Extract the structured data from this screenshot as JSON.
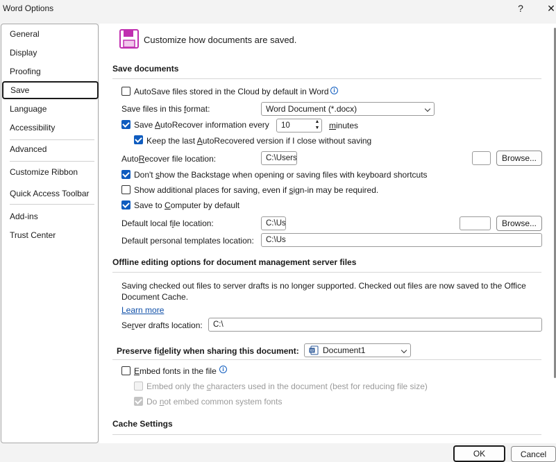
{
  "window": {
    "title": "Word Options",
    "help_glyph": "?",
    "close_glyph": "✕"
  },
  "sidebar": {
    "items": [
      {
        "label": "General"
      },
      {
        "label": "Display"
      },
      {
        "label": "Proofing"
      },
      {
        "label": "Save",
        "selected": true
      },
      {
        "label": "Language"
      },
      {
        "label": "Accessibility"
      },
      {
        "label": "Advanced"
      },
      {
        "label": "Customize Ribbon"
      },
      {
        "label": "Quick Access Toolbar"
      },
      {
        "label": "Add-ins"
      },
      {
        "label": "Trust Center"
      }
    ]
  },
  "header": {
    "icon": "floppy-disk-icon",
    "text": "Customize how documents are saved."
  },
  "save_documents": {
    "heading": "Save documents",
    "autosave_label": "AutoSave files stored in the Cloud by default in Word",
    "autosave_checked": false,
    "format_label_pre": "Save files in this ",
    "format_label_u": "f",
    "format_label_post": "ormat:",
    "format_value": "Word Document (*.docx)",
    "autorecover_pre": "Save ",
    "autorecover_u": "A",
    "autorecover_post": "utoRecover information every",
    "autorecover_checked": true,
    "autorecover_minutes": "10",
    "minutes_u": "m",
    "minutes_rest": "inutes",
    "keep_pre": "Keep the last ",
    "keep_u": "A",
    "keep_post": "utoRecovered version if I close without saving",
    "keep_checked": true,
    "ar_location_pre": "Auto",
    "ar_location_u": "R",
    "ar_location_post": "ecover file location:",
    "ar_location_value": "C:\\Users",
    "browse_label": "Browse...",
    "backstage_pre": "Don't ",
    "backstage_u": "s",
    "backstage_post": "how the Backstage when opening or saving files with keyboard shortcuts",
    "backstage_checked": true,
    "additional_pre": "Show additional places for saving, even if ",
    "additional_u": "s",
    "additional_post": "ign-in may be required.",
    "additional_checked": false,
    "computer_pre": "Save to ",
    "computer_u": "C",
    "computer_post": "omputer by default",
    "computer_checked": true,
    "local_pre": "Default local f",
    "local_u": "i",
    "local_post": "le location:",
    "local_value": "C:\\Us",
    "templates_label": "Default personal templates location:",
    "templates_value": "C:\\Us"
  },
  "offline": {
    "heading": "Offline editing options for document management server files",
    "notice_line1": "Saving checked out files to server drafts is no longer supported. Checked out files are now saved to the Office",
    "notice_line2": "Document Cache.",
    "learn_more": "Learn more",
    "drafts_pre": "Se",
    "drafts_u": "r",
    "drafts_post": "ver drafts location:",
    "drafts_value": "C:\\"
  },
  "fidelity": {
    "heading_pre": "Preserve fi",
    "heading_u": "d",
    "heading_post": "elity when sharing this document:",
    "document_value": "Document1",
    "embed_pre": "",
    "embed_u": "E",
    "embed_post": "mbed fonts in the file",
    "embed_checked": false,
    "only_pre": "Embed only the ",
    "only_u": "c",
    "only_post": "haracters used in the document (best for reducing file size)",
    "only_checked": false,
    "common_pre": "Do ",
    "common_u": "n",
    "common_post": "ot embed common system fonts",
    "common_checked": true
  },
  "cache": {
    "heading": "Cache Settings"
  },
  "footer": {
    "ok_label": "OK",
    "cancel_label": "Cancel"
  },
  "colors": {
    "accent": "#0f5cbf",
    "icon_magenta": "#c02fb0"
  }
}
